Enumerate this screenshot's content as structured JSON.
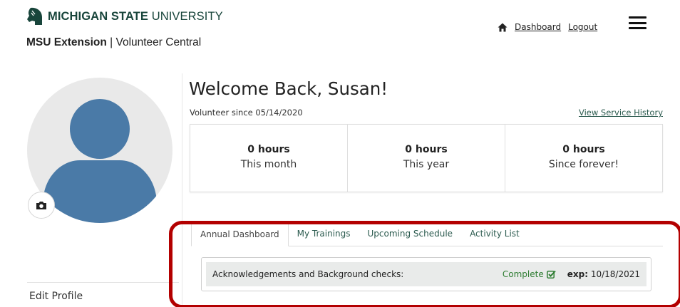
{
  "header": {
    "university_bold": "MICHIGAN STATE",
    "university_light": "UNIVERSITY",
    "subtitle_bold": "MSU Extension",
    "subtitle_rest": " | Volunteer Central"
  },
  "nav": {
    "dashboard_label": "Dashboard",
    "logout_label": "Logout"
  },
  "profile": {
    "welcome": "Welcome Back, Susan!",
    "volunteer_since": "Volunteer since 05/14/2020",
    "service_history_link": "View Service History",
    "edit_profile_label": "Edit Profile"
  },
  "stats": [
    {
      "value": "0 hours",
      "label": "This month"
    },
    {
      "value": "0 hours",
      "label": "This year"
    },
    {
      "value": "0 hours",
      "label": "Since forever!"
    }
  ],
  "tabs": [
    {
      "label": "Annual Dashboard",
      "active": true
    },
    {
      "label": "My Trainings",
      "active": false
    },
    {
      "label": "Upcoming Schedule",
      "active": false
    },
    {
      "label": "Activity List",
      "active": false
    }
  ],
  "acknowledgement": {
    "label": "Acknowledgements and Background checks:",
    "status": "Complete",
    "exp_label": "exp:",
    "exp_date": " 10/18/2021"
  },
  "icons": {
    "logo": "spartan-helmet-icon",
    "home": "home-icon",
    "menu": "hamburger-menu-icon",
    "camera": "camera-icon",
    "check": "checkbox-checked-icon"
  },
  "colors": {
    "msu_green": "#18453b",
    "link_green": "#2c5b4f",
    "avatar_blue": "#4a7aa7",
    "complete_green": "#2e7d32",
    "highlight_red": "#b30000"
  }
}
